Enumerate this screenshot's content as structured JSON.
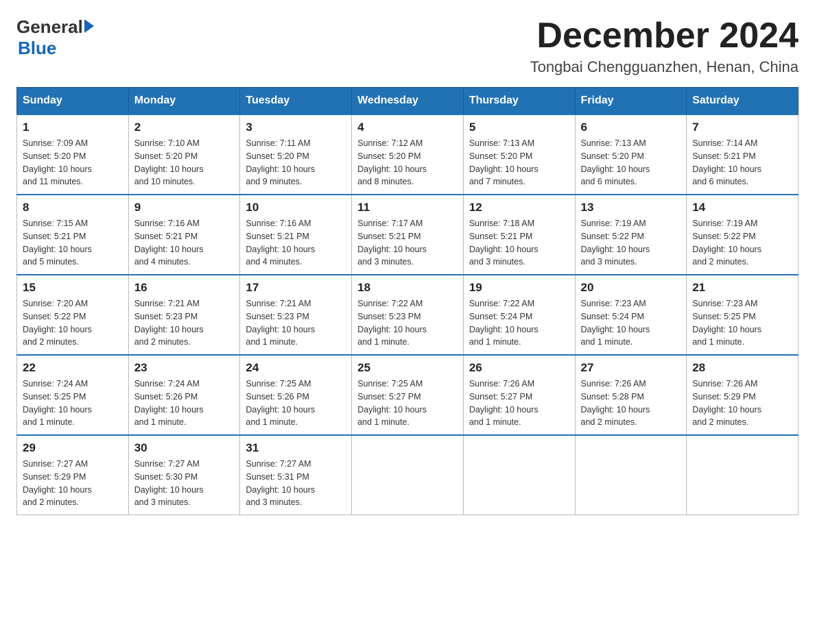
{
  "header": {
    "logo_general": "General",
    "logo_blue": "Blue",
    "month_title": "December 2024",
    "location": "Tongbai Chengguanzhen, Henan, China"
  },
  "weekdays": [
    "Sunday",
    "Monday",
    "Tuesday",
    "Wednesday",
    "Thursday",
    "Friday",
    "Saturday"
  ],
  "weeks": [
    [
      {
        "day": "1",
        "sunrise": "7:09 AM",
        "sunset": "5:20 PM",
        "daylight": "10 hours and 11 minutes."
      },
      {
        "day": "2",
        "sunrise": "7:10 AM",
        "sunset": "5:20 PM",
        "daylight": "10 hours and 10 minutes."
      },
      {
        "day": "3",
        "sunrise": "7:11 AM",
        "sunset": "5:20 PM",
        "daylight": "10 hours and 9 minutes."
      },
      {
        "day": "4",
        "sunrise": "7:12 AM",
        "sunset": "5:20 PM",
        "daylight": "10 hours and 8 minutes."
      },
      {
        "day": "5",
        "sunrise": "7:13 AM",
        "sunset": "5:20 PM",
        "daylight": "10 hours and 7 minutes."
      },
      {
        "day": "6",
        "sunrise": "7:13 AM",
        "sunset": "5:20 PM",
        "daylight": "10 hours and 6 minutes."
      },
      {
        "day": "7",
        "sunrise": "7:14 AM",
        "sunset": "5:21 PM",
        "daylight": "10 hours and 6 minutes."
      }
    ],
    [
      {
        "day": "8",
        "sunrise": "7:15 AM",
        "sunset": "5:21 PM",
        "daylight": "10 hours and 5 minutes."
      },
      {
        "day": "9",
        "sunrise": "7:16 AM",
        "sunset": "5:21 PM",
        "daylight": "10 hours and 4 minutes."
      },
      {
        "day": "10",
        "sunrise": "7:16 AM",
        "sunset": "5:21 PM",
        "daylight": "10 hours and 4 minutes."
      },
      {
        "day": "11",
        "sunrise": "7:17 AM",
        "sunset": "5:21 PM",
        "daylight": "10 hours and 3 minutes."
      },
      {
        "day": "12",
        "sunrise": "7:18 AM",
        "sunset": "5:21 PM",
        "daylight": "10 hours and 3 minutes."
      },
      {
        "day": "13",
        "sunrise": "7:19 AM",
        "sunset": "5:22 PM",
        "daylight": "10 hours and 3 minutes."
      },
      {
        "day": "14",
        "sunrise": "7:19 AM",
        "sunset": "5:22 PM",
        "daylight": "10 hours and 2 minutes."
      }
    ],
    [
      {
        "day": "15",
        "sunrise": "7:20 AM",
        "sunset": "5:22 PM",
        "daylight": "10 hours and 2 minutes."
      },
      {
        "day": "16",
        "sunrise": "7:21 AM",
        "sunset": "5:23 PM",
        "daylight": "10 hours and 2 minutes."
      },
      {
        "day": "17",
        "sunrise": "7:21 AM",
        "sunset": "5:23 PM",
        "daylight": "10 hours and 1 minute."
      },
      {
        "day": "18",
        "sunrise": "7:22 AM",
        "sunset": "5:23 PM",
        "daylight": "10 hours and 1 minute."
      },
      {
        "day": "19",
        "sunrise": "7:22 AM",
        "sunset": "5:24 PM",
        "daylight": "10 hours and 1 minute."
      },
      {
        "day": "20",
        "sunrise": "7:23 AM",
        "sunset": "5:24 PM",
        "daylight": "10 hours and 1 minute."
      },
      {
        "day": "21",
        "sunrise": "7:23 AM",
        "sunset": "5:25 PM",
        "daylight": "10 hours and 1 minute."
      }
    ],
    [
      {
        "day": "22",
        "sunrise": "7:24 AM",
        "sunset": "5:25 PM",
        "daylight": "10 hours and 1 minute."
      },
      {
        "day": "23",
        "sunrise": "7:24 AM",
        "sunset": "5:26 PM",
        "daylight": "10 hours and 1 minute."
      },
      {
        "day": "24",
        "sunrise": "7:25 AM",
        "sunset": "5:26 PM",
        "daylight": "10 hours and 1 minute."
      },
      {
        "day": "25",
        "sunrise": "7:25 AM",
        "sunset": "5:27 PM",
        "daylight": "10 hours and 1 minute."
      },
      {
        "day": "26",
        "sunrise": "7:26 AM",
        "sunset": "5:27 PM",
        "daylight": "10 hours and 1 minute."
      },
      {
        "day": "27",
        "sunrise": "7:26 AM",
        "sunset": "5:28 PM",
        "daylight": "10 hours and 2 minutes."
      },
      {
        "day": "28",
        "sunrise": "7:26 AM",
        "sunset": "5:29 PM",
        "daylight": "10 hours and 2 minutes."
      }
    ],
    [
      {
        "day": "29",
        "sunrise": "7:27 AM",
        "sunset": "5:29 PM",
        "daylight": "10 hours and 2 minutes."
      },
      {
        "day": "30",
        "sunrise": "7:27 AM",
        "sunset": "5:30 PM",
        "daylight": "10 hours and 3 minutes."
      },
      {
        "day": "31",
        "sunrise": "7:27 AM",
        "sunset": "5:31 PM",
        "daylight": "10 hours and 3 minutes."
      },
      null,
      null,
      null,
      null
    ]
  ],
  "labels": {
    "sunrise": "Sunrise:",
    "sunset": "Sunset:",
    "daylight": "Daylight:"
  }
}
